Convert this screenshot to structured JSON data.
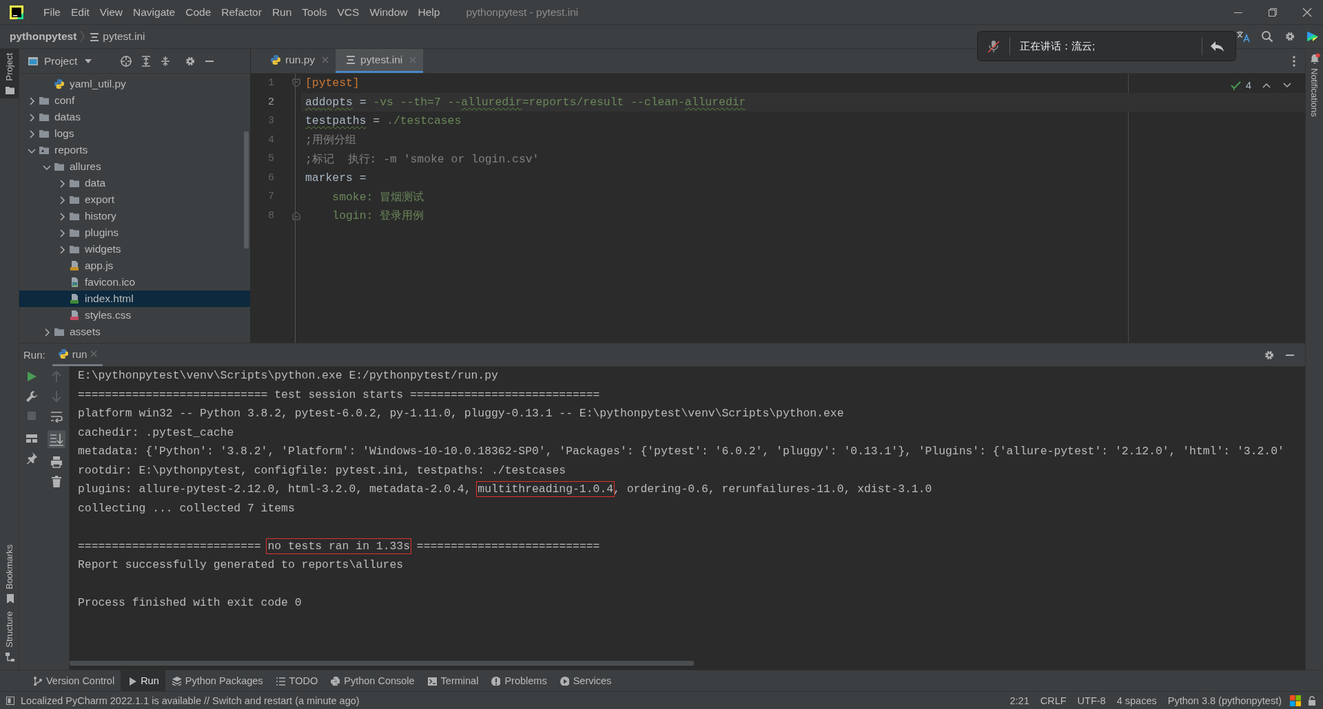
{
  "title_bar": {
    "menu": [
      "File",
      "Edit",
      "View",
      "Navigate",
      "Code",
      "Refactor",
      "Run",
      "Tools",
      "VCS",
      "Window",
      "Help"
    ],
    "title": "pythonpytest - pytest.ini"
  },
  "nav_bar": {
    "project": "pythonpytest",
    "file": "pytest.ini"
  },
  "voice_popup": {
    "text": "正在讲话：流云;"
  },
  "left_stripe": [
    {
      "label": "Project",
      "selected": true
    },
    {
      "label": "Bookmarks",
      "selected": false
    },
    {
      "label": "Structure",
      "selected": false
    }
  ],
  "right_stripe": [
    {
      "label": "Notifications"
    }
  ],
  "project_panel": {
    "title": "Project",
    "tree": [
      {
        "children": [
          {
            "label": "yaml_util.py",
            "kind": "py",
            "selected": false
          }
        ]
      },
      {
        "label": "conf",
        "kind": "folder",
        "expanded": false,
        "selected": false
      },
      {
        "label": "datas",
        "kind": "folder",
        "expanded": false,
        "selected": false
      },
      {
        "label": "logs",
        "kind": "folder",
        "expanded": false,
        "selected": false
      },
      {
        "label": "reports",
        "kind": "marked-folder",
        "expanded": true,
        "selected": false,
        "children": [
          {
            "label": "allures",
            "kind": "folder",
            "expanded": true,
            "selected": false,
            "children": [
              {
                "label": "data",
                "kind": "folder",
                "expanded": false,
                "selected": false
              },
              {
                "label": "export",
                "kind": "folder",
                "expanded": false,
                "selected": false
              },
              {
                "label": "history",
                "kind": "folder",
                "expanded": false,
                "selected": false
              },
              {
                "label": "plugins",
                "kind": "folder",
                "expanded": false,
                "selected": false
              },
              {
                "label": "widgets",
                "kind": "folder",
                "expanded": false,
                "selected": false
              },
              {
                "label": "app.js",
                "kind": "js",
                "selected": false
              },
              {
                "label": "favicon.ico",
                "kind": "ico",
                "selected": false
              },
              {
                "label": "index.html",
                "kind": "html",
                "selected": true
              },
              {
                "label": "styles.css",
                "kind": "css",
                "selected": false
              }
            ]
          },
          {
            "label": "assets",
            "kind": "folder",
            "expanded": false,
            "selected": false
          }
        ]
      }
    ]
  },
  "editor": {
    "tabs": [
      {
        "label": "run.py",
        "kind": "py",
        "selected": false
      },
      {
        "label": "pytest.ini",
        "kind": "ini",
        "selected": true
      }
    ],
    "inspection_count": "4",
    "lines": [
      {
        "number": "1",
        "current": false,
        "fold_start": true,
        "segments": [
          {
            "text": "[pytest]",
            "kind": "section"
          }
        ]
      },
      {
        "number": "2",
        "current": true,
        "segments": [
          {
            "text": "addopts",
            "kind": "key",
            "typo": true
          },
          {
            "text": " = ",
            "kind": "op"
          },
          {
            "text": "-vs --th=7 --",
            "kind": "value"
          },
          {
            "text": "alluredir",
            "kind": "value",
            "typo": true
          },
          {
            "text": "=reports/result --clean-",
            "kind": "value"
          },
          {
            "text": "alluredir",
            "kind": "value",
            "typo": true
          }
        ]
      },
      {
        "number": "3",
        "current": false,
        "segments": [
          {
            "text": "testpaths",
            "kind": "key",
            "typo": true
          },
          {
            "text": " = ",
            "kind": "op"
          },
          {
            "text": "./testcases",
            "kind": "value"
          }
        ]
      },
      {
        "number": "4",
        "current": false,
        "segments": [
          {
            "text": ";用例分组",
            "kind": "comment"
          }
        ]
      },
      {
        "number": "5",
        "current": false,
        "segments": [
          {
            "text": ";标记  执行: -m 'smoke or login.csv'",
            "kind": "comment"
          }
        ]
      },
      {
        "number": "6",
        "current": false,
        "segments": [
          {
            "text": "markers =",
            "kind": "key"
          }
        ]
      },
      {
        "number": "7",
        "current": false,
        "segments": [
          {
            "text": "    smoke: 冒烟测试",
            "kind": "value"
          }
        ]
      },
      {
        "number": "8",
        "current": false,
        "fold_end": true,
        "segments": [
          {
            "text": "    login: 登录用例",
            "kind": "value"
          }
        ]
      }
    ]
  },
  "run_panel": {
    "label": "Run:",
    "tabs": [
      {
        "label": "run",
        "selected": true
      }
    ],
    "console": [
      {
        "segments": [
          {
            "text": "E:\\pythonpytest\\venv\\Scripts\\python.exe E:/pythonpytest/run.py"
          }
        ]
      },
      {
        "segments": [
          {
            "text": "============================ test session starts ============================"
          }
        ]
      },
      {
        "segments": [
          {
            "text": "platform win32 -- Python 3.8.2, pytest-6.0.2, py-1.11.0, pluggy-0.13.1 -- E:\\pythonpytest\\venv\\Scripts\\python.exe"
          }
        ]
      },
      {
        "segments": [
          {
            "text": "cachedir: .pytest_cache"
          }
        ]
      },
      {
        "segments": [
          {
            "text": "metadata: {'Python': '3.8.2', 'Platform': 'Windows-10-10.0.18362-SP0', 'Packages': {'pytest': '6.0.2', 'pluggy': '0.13.1'}, 'Plugins': {'allure-pytest': '2.12.0', 'html': '3.2.0'"
          }
        ]
      },
      {
        "segments": [
          {
            "text": "rootdir: E:\\pythonpytest, configfile: pytest.ini, testpaths: ./testcases"
          }
        ]
      },
      {
        "segments": [
          {
            "text": "plugins: allure-pytest-2.12.0, html-3.2.0, metadata-2.0.4, "
          },
          {
            "text": "multithreading-1.0.4",
            "boxed": true
          },
          {
            "text": ", ordering-0.6, rerunfailures-11.0, xdist-3.1.0"
          }
        ]
      },
      {
        "segments": [
          {
            "text": "collecting ... collected 7 items"
          }
        ]
      },
      {
        "space_before": true,
        "segments": [
          {
            "text": "=========================== "
          },
          {
            "text": "no tests ran in 1.33s",
            "boxed": true
          },
          {
            "text": " ==========================="
          }
        ]
      },
      {
        "segments": [
          {
            "text": "Report successfully generated to reports\\allures"
          }
        ]
      },
      {
        "space_before": true,
        "segments": [
          {
            "text": "Process finished with exit code 0"
          }
        ]
      }
    ]
  },
  "tool_windows": [
    {
      "label": "Version Control",
      "selected": false
    },
    {
      "label": "Run",
      "selected": true
    },
    {
      "label": "Python Packages",
      "selected": false
    },
    {
      "label": "TODO",
      "selected": false
    },
    {
      "label": "Python Console",
      "selected": false
    },
    {
      "label": "Terminal",
      "selected": false
    },
    {
      "label": "Problems",
      "selected": false
    },
    {
      "label": "Services",
      "selected": false
    }
  ],
  "status_bar": {
    "message": "Localized PyCharm 2022.1.1 is available // Switch and restart (a minute ago)",
    "items": [
      "2:21",
      "CRLF",
      "UTF-8",
      "4 spaces",
      "Python 3.8 (pythonpytest)"
    ]
  }
}
